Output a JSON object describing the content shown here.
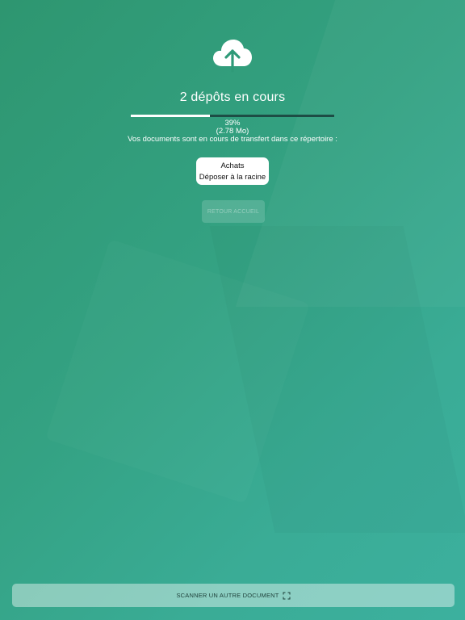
{
  "upload": {
    "title": "2 dépôts en cours",
    "progress_fraction": 0.39,
    "percent_label": "39%",
    "size_label": "(2.78 Mo)",
    "destination_text": "Vos documents sont en cours de transfert dans ce répertoire :",
    "icon": "cloud-upload-icon"
  },
  "folder": {
    "name": "Achats",
    "action_label": "Déposer à la racine"
  },
  "buttons": {
    "home_label": "RETOUR ACCUEIL",
    "scan_label": "SCANNER UN AUTRE DOCUMENT",
    "scan_icon": "scan-frame-icon"
  },
  "colors": {
    "background_start": "#2e9670",
    "background_end": "#3cb09e",
    "progress_track": "#1d4d45",
    "progress_fill": "#ffffff"
  }
}
